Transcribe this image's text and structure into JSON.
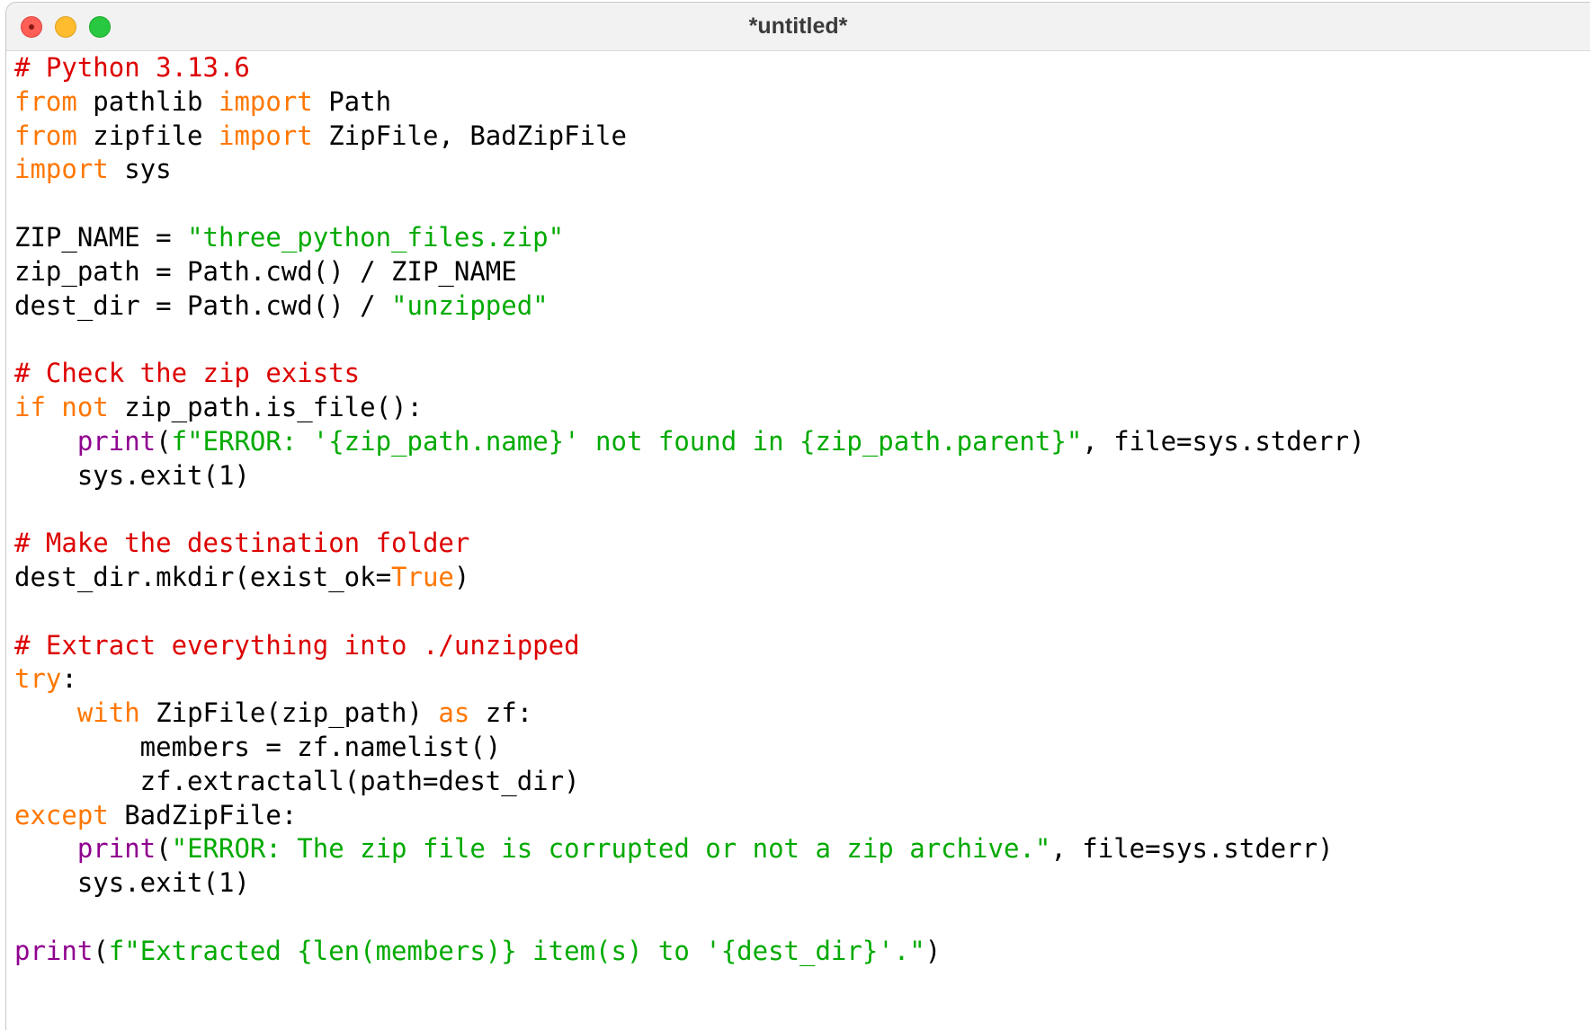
{
  "window": {
    "title": "*untitled*"
  },
  "colors": {
    "comment": "#dd0000",
    "keyword": "#ff7700",
    "builtin": "#900090",
    "string": "#00aa00",
    "text": "#000000"
  },
  "icons": {
    "close": "close-icon",
    "minimize": "minimize-icon",
    "maximize": "maximize-icon"
  },
  "code_lines": [
    [
      {
        "t": "comment",
        "v": "# Python 3.13.6"
      }
    ],
    [
      {
        "t": "keyword",
        "v": "from"
      },
      {
        "t": "text",
        "v": " pathlib "
      },
      {
        "t": "keyword",
        "v": "import"
      },
      {
        "t": "text",
        "v": " Path"
      }
    ],
    [
      {
        "t": "keyword",
        "v": "from"
      },
      {
        "t": "text",
        "v": " zipfile "
      },
      {
        "t": "keyword",
        "v": "import"
      },
      {
        "t": "text",
        "v": " ZipFile, BadZipFile"
      }
    ],
    [
      {
        "t": "keyword",
        "v": "import"
      },
      {
        "t": "text",
        "v": " sys"
      }
    ],
    [],
    [
      {
        "t": "text",
        "v": "ZIP_NAME = "
      },
      {
        "t": "string",
        "v": "\"three_python_files.zip\""
      }
    ],
    [
      {
        "t": "text",
        "v": "zip_path = Path.cwd() / ZIP_NAME"
      }
    ],
    [
      {
        "t": "text",
        "v": "dest_dir = Path.cwd() / "
      },
      {
        "t": "string",
        "v": "\"unzipped\""
      }
    ],
    [],
    [
      {
        "t": "comment",
        "v": "# Check the zip exists"
      }
    ],
    [
      {
        "t": "keyword",
        "v": "if"
      },
      {
        "t": "text",
        "v": " "
      },
      {
        "t": "keyword",
        "v": "not"
      },
      {
        "t": "text",
        "v": " zip_path.is_file():"
      }
    ],
    [
      {
        "t": "text",
        "v": "    "
      },
      {
        "t": "builtin",
        "v": "print"
      },
      {
        "t": "text",
        "v": "("
      },
      {
        "t": "string",
        "v": "f\"ERROR: '{zip_path.name}' not found in {zip_path.parent}\""
      },
      {
        "t": "text",
        "v": ", file=sys.stderr)"
      }
    ],
    [
      {
        "t": "text",
        "v": "    sys.exit(1)"
      }
    ],
    [],
    [
      {
        "t": "comment",
        "v": "# Make the destination folder"
      }
    ],
    [
      {
        "t": "text",
        "v": "dest_dir.mkdir(exist_ok="
      },
      {
        "t": "keyword",
        "v": "True"
      },
      {
        "t": "text",
        "v": ")"
      }
    ],
    [],
    [
      {
        "t": "comment",
        "v": "# Extract everything into ./unzipped"
      }
    ],
    [
      {
        "t": "keyword",
        "v": "try"
      },
      {
        "t": "text",
        "v": ":"
      }
    ],
    [
      {
        "t": "text",
        "v": "    "
      },
      {
        "t": "keyword",
        "v": "with"
      },
      {
        "t": "text",
        "v": " ZipFile(zip_path) "
      },
      {
        "t": "keyword",
        "v": "as"
      },
      {
        "t": "text",
        "v": " zf:"
      }
    ],
    [
      {
        "t": "text",
        "v": "        members = zf.namelist()"
      }
    ],
    [
      {
        "t": "text",
        "v": "        zf.extractall(path=dest_dir)"
      }
    ],
    [
      {
        "t": "keyword",
        "v": "except"
      },
      {
        "t": "text",
        "v": " BadZipFile:"
      }
    ],
    [
      {
        "t": "text",
        "v": "    "
      },
      {
        "t": "builtin",
        "v": "print"
      },
      {
        "t": "text",
        "v": "("
      },
      {
        "t": "string",
        "v": "\"ERROR: The zip file is corrupted or not a zip archive.\""
      },
      {
        "t": "text",
        "v": ", file=sys.stderr)"
      }
    ],
    [
      {
        "t": "text",
        "v": "    sys.exit(1)"
      }
    ],
    [],
    [
      {
        "t": "builtin",
        "v": "print"
      },
      {
        "t": "text",
        "v": "("
      },
      {
        "t": "string",
        "v": "f\"Extracted {len(members)} item(s) to '{dest_dir}'.\""
      },
      {
        "t": "text",
        "v": ")"
      }
    ]
  ]
}
